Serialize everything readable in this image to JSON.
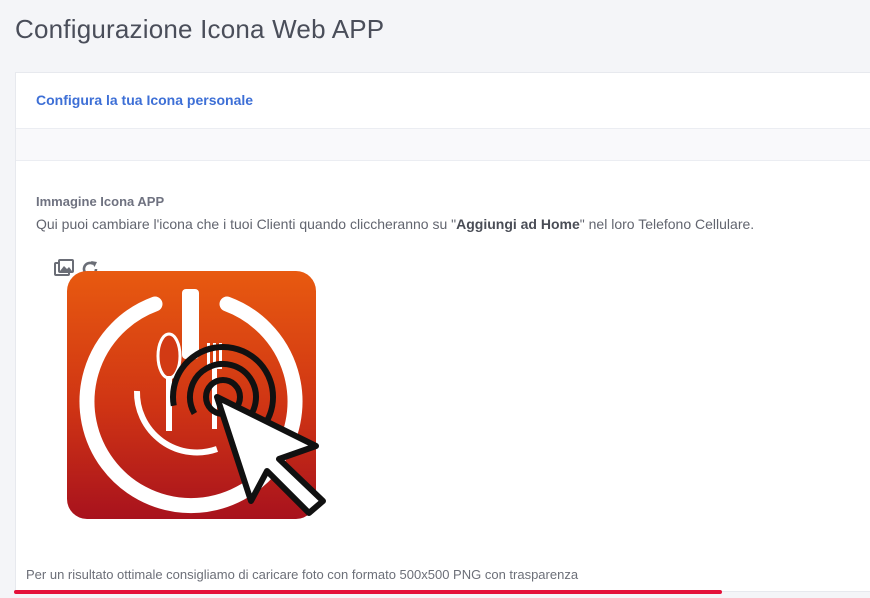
{
  "page": {
    "title": "Configurazione Icona Web APP"
  },
  "card": {
    "header_link": "Configura la tua Icona personale",
    "field": {
      "label": "Immagine Icona APP",
      "desc_prefix": "Qui puoi cambiare l'icona che i tuoi Clienti quando cliccheranno su \"",
      "desc_bold": "Aggiungi ad Home",
      "desc_suffix": "\" nel loro Telefono Cellulare."
    },
    "tools": [
      "image-icon",
      "refresh-icon"
    ],
    "help_text": "Per un risultato ottimale consigliamo di caricare foto con formato 500x500 PNG con trasparenza"
  },
  "colors": {
    "accent_link": "#3d6fd6",
    "icon_gradient_top": "#e85a10",
    "icon_gradient_bottom": "#a8121d",
    "underline": "#e4113a"
  }
}
